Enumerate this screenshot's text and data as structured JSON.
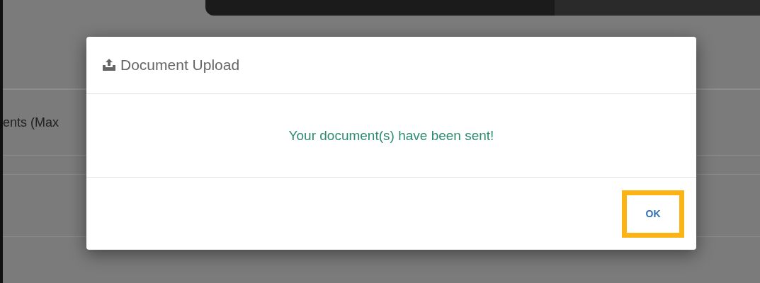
{
  "background": {
    "row_label": "ents (Max"
  },
  "dialog": {
    "title": "Document Upload",
    "message": "Your document(s) have been sent!",
    "button": {
      "label": "OK",
      "highlighted": true
    }
  }
}
